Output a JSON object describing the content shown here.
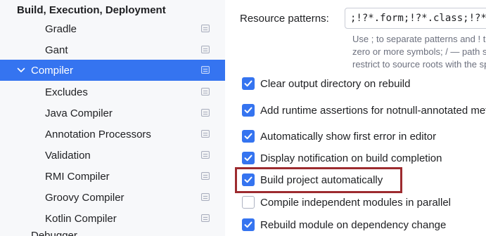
{
  "sidebar": {
    "section_title": "Build, Execution, Deployment",
    "items": [
      {
        "label": "Gradle",
        "level": 2
      },
      {
        "label": "Gant",
        "level": 2
      },
      {
        "label": "Compiler",
        "level": 1,
        "selected": true,
        "expanded": true
      },
      {
        "label": "Excludes",
        "level": 2
      },
      {
        "label": "Java Compiler",
        "level": 2
      },
      {
        "label": "Annotation Processors",
        "level": 2
      },
      {
        "label": "Validation",
        "level": 2
      },
      {
        "label": "RMI Compiler",
        "level": 2
      },
      {
        "label": "Groovy Compiler",
        "level": 2
      },
      {
        "label": "Kotlin Compiler",
        "level": 2
      }
    ],
    "cut_item": "Debugger"
  },
  "panel": {
    "resource_patterns_label": "Resource patterns:",
    "resource_patterns_value": ";!?*.form;!?*.class;!?*.groovy;!?*.scala;!?*.flex;!?*.kt;!?*.clj;!?*.aj",
    "hint_lines": [
      "Use ; to separate patterns and ! to negate a pattern. Accepted wildcards: ? — exactly one symbol; * —",
      "zero or more symbols; / — path separator; /**/ — any number of directories; <dir_name>:<pattern> —",
      "restrict to source roots with the specified name"
    ],
    "options": [
      {
        "label": "Clear output directory on rebuild",
        "checked": true
      },
      {
        "label": "Add runtime assertions for notnull-annotated methods and parameters",
        "checked": true
      },
      {
        "label": "Automatically show first error in editor",
        "checked": true
      },
      {
        "label": "Display notification on build completion",
        "checked": true
      },
      {
        "label": "Build project automatically",
        "checked": true,
        "highlighted": true
      },
      {
        "label": "Compile independent modules in parallel",
        "checked": false
      },
      {
        "label": "Rebuild module on dependency change",
        "checked": true
      }
    ]
  },
  "colors": {
    "accent": "#3574f0",
    "highlight_border": "#9d2b2f",
    "sidebar_bg": "#f7f8fa",
    "panel_bg": "#ffffff"
  }
}
